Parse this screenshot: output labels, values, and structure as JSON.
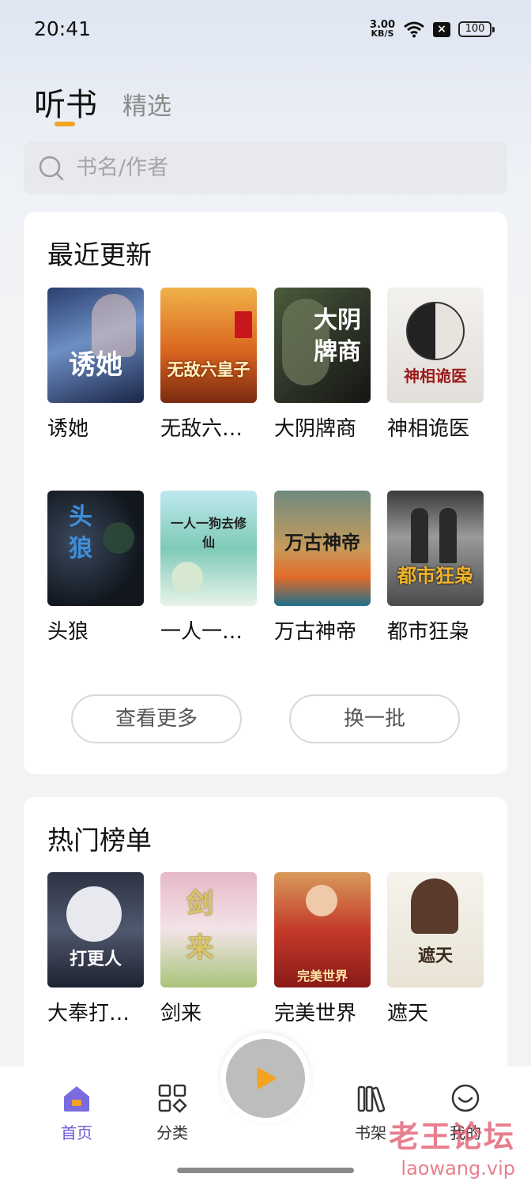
{
  "status": {
    "time": "20:41",
    "net_speed_value": "3.00",
    "net_speed_unit": "KB/S",
    "battery": "100"
  },
  "tabs": {
    "active": "听书",
    "other": "精选"
  },
  "search": {
    "placeholder": "书名/作者"
  },
  "recent": {
    "title": "最近更新",
    "books": [
      {
        "name": "诱她",
        "cover_text": "诱她"
      },
      {
        "name": "无敌六皇子",
        "cover_text": "无敌六皇子"
      },
      {
        "name": "大阴牌商",
        "cover_text": "大阴牌商"
      },
      {
        "name": "神相诡医",
        "cover_text": "神相诡医"
      },
      {
        "name": "头狼",
        "cover_text": "头狼"
      },
      {
        "name": "一人一狗去修仙",
        "cover_text": "一人一狗去修仙"
      },
      {
        "name": "万古神帝",
        "cover_text": "万古神帝"
      },
      {
        "name": "都市狂枭",
        "cover_text": "都市狂枭"
      }
    ],
    "more_button": "查看更多",
    "refresh_button": "换一批"
  },
  "hot": {
    "title": "热门榜单",
    "books": [
      {
        "name": "大奉打更人",
        "cover_text": "打更人"
      },
      {
        "name": "剑来",
        "cover_text": "剑来"
      },
      {
        "name": "完美世界",
        "cover_text": "完美世界"
      },
      {
        "name": "遮天",
        "cover_text": "遮天"
      }
    ]
  },
  "nav": {
    "home": "首页",
    "category": "分类",
    "shelf": "书架",
    "mine": "我的"
  },
  "watermark": {
    "main": "老王论坛",
    "sub": "laowang.vip"
  },
  "colors": {
    "accent_tab": "#f2a322",
    "nav_active": "#6a5bd6",
    "play_icon": "#f2a322"
  }
}
